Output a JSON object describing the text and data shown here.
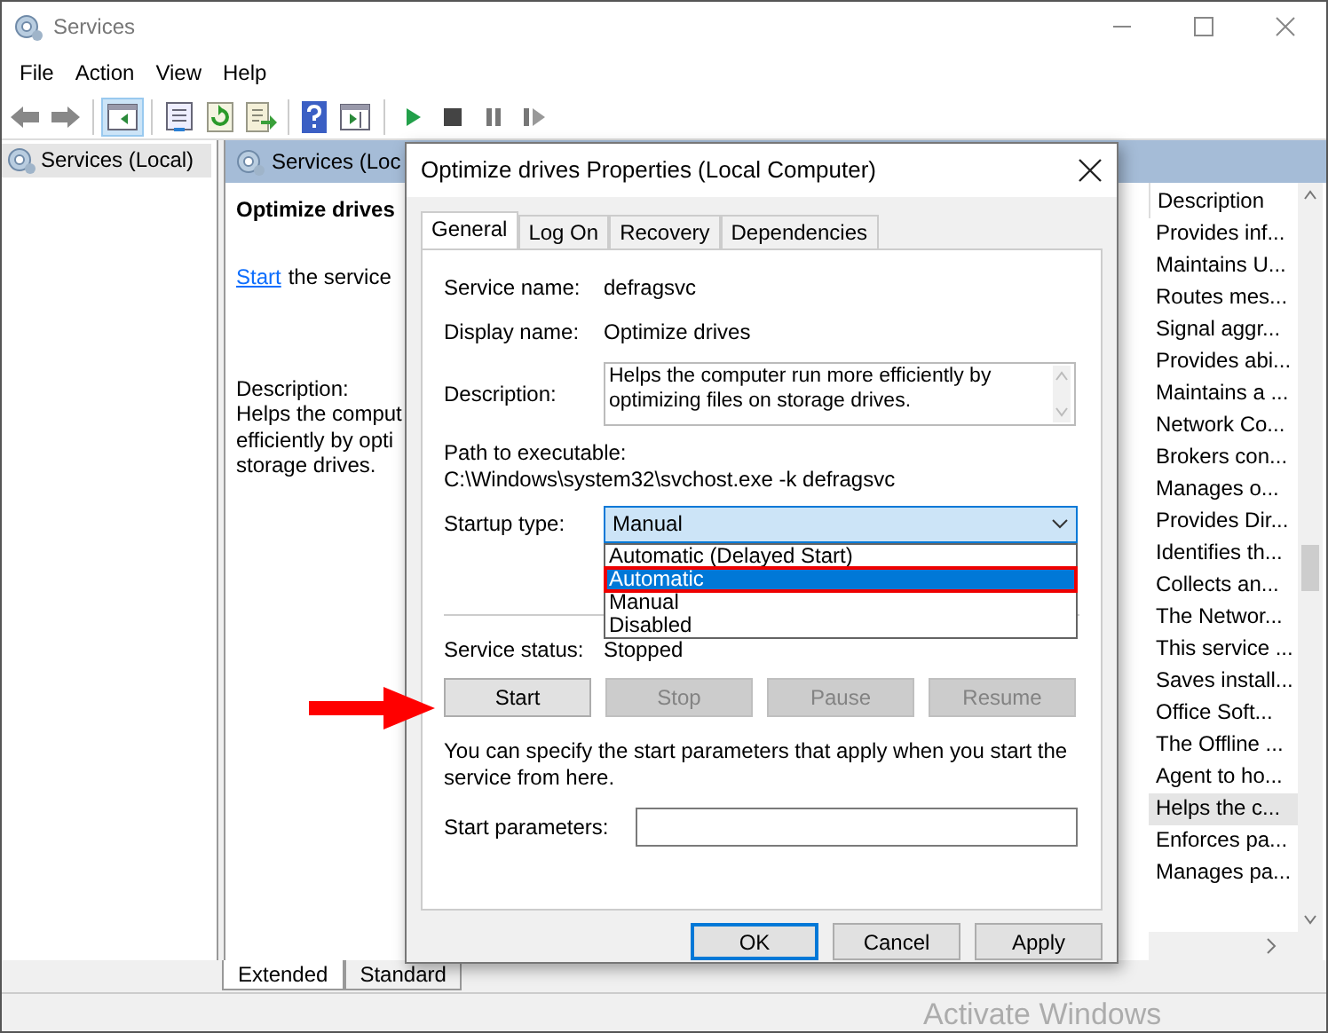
{
  "window": {
    "title": "Services"
  },
  "menu": [
    "File",
    "Action",
    "View",
    "Help"
  ],
  "tree": [
    {
      "label": "Services (Local)",
      "selected": true
    }
  ],
  "panel": {
    "header": "Services (Loc",
    "service_title": "Optimize drives",
    "start_link": "Start",
    "start_suffix": "the service",
    "description_label": "Description:",
    "description_lines": [
      "Helps the comput",
      "efficiently by opti",
      "storage drives."
    ]
  },
  "list": {
    "columns": [
      "Description"
    ],
    "rows": [
      {
        "text": "Provides inf...",
        "selected": false
      },
      {
        "text": "Maintains U...",
        "selected": false
      },
      {
        "text": "Routes mes...",
        "selected": false
      },
      {
        "text": "Signal aggr...",
        "selected": false
      },
      {
        "text": "Provides abi...",
        "selected": false
      },
      {
        "text": "Maintains a ...",
        "selected": false
      },
      {
        "text": "Network Co...",
        "selected": false
      },
      {
        "text": "Brokers con...",
        "selected": false
      },
      {
        "text": "Manages o...",
        "selected": false
      },
      {
        "text": "Provides Dir...",
        "selected": false
      },
      {
        "text": "Identifies th...",
        "selected": false
      },
      {
        "text": "Collects an...",
        "selected": false
      },
      {
        "text": "The Networ...",
        "selected": false
      },
      {
        "text": "This service ...",
        "selected": false
      },
      {
        "text": "Saves install...",
        "selected": false
      },
      {
        "text": "Office Soft...",
        "selected": false
      },
      {
        "text": "The Offline ...",
        "selected": false
      },
      {
        "text": "Agent to ho...",
        "selected": false
      },
      {
        "text": "Helps the c...",
        "selected": true
      },
      {
        "text": "Enforces pa...",
        "selected": false
      },
      {
        "text": "Manages pa...",
        "selected": false
      }
    ]
  },
  "view_tabs": [
    {
      "label": "Extended",
      "selected": true
    },
    {
      "label": "Standard",
      "selected": false
    }
  ],
  "dialog": {
    "title": "Optimize drives Properties (Local Computer)",
    "tabs": [
      {
        "label": "General",
        "selected": true
      },
      {
        "label": "Log On",
        "selected": false
      },
      {
        "label": "Recovery",
        "selected": false
      },
      {
        "label": "Dependencies",
        "selected": false
      }
    ],
    "service_name": {
      "label": "Service name:",
      "value": "defragsvc"
    },
    "display_name": {
      "label": "Display name:",
      "value": "Optimize drives"
    },
    "description": {
      "label": "Description:",
      "value": "Helps the computer run more efficiently by optimizing files on storage drives."
    },
    "path": {
      "label": "Path to executable:",
      "value": "C:\\Windows\\system32\\svchost.exe -k defragsvc"
    },
    "startup_type": {
      "label": "Startup type:",
      "value": "Manual",
      "options": [
        {
          "label": "Automatic (Delayed Start)",
          "highlighted": false,
          "callout": false
        },
        {
          "label": "Automatic",
          "highlighted": true,
          "callout": true
        },
        {
          "label": "Manual",
          "highlighted": false,
          "callout": false
        },
        {
          "label": "Disabled",
          "highlighted": false,
          "callout": false
        }
      ]
    },
    "service_status": {
      "label": "Service status:",
      "value": "Stopped"
    },
    "service_buttons": [
      {
        "label": "Start",
        "disabled": false,
        "callout": true
      },
      {
        "label": "Stop",
        "disabled": true,
        "callout": false
      },
      {
        "label": "Pause",
        "disabled": true,
        "callout": false
      },
      {
        "label": "Resume",
        "disabled": true,
        "callout": false
      }
    ],
    "hint": "You can specify the start parameters that apply when you start the service from here.",
    "start_parameters": {
      "label": "Start parameters:"
    },
    "buttons": [
      {
        "label": "OK",
        "default": true
      },
      {
        "label": "Cancel",
        "default": false
      },
      {
        "label": "Apply",
        "default": false
      }
    ]
  },
  "overlay_text": "Activate Windows"
}
